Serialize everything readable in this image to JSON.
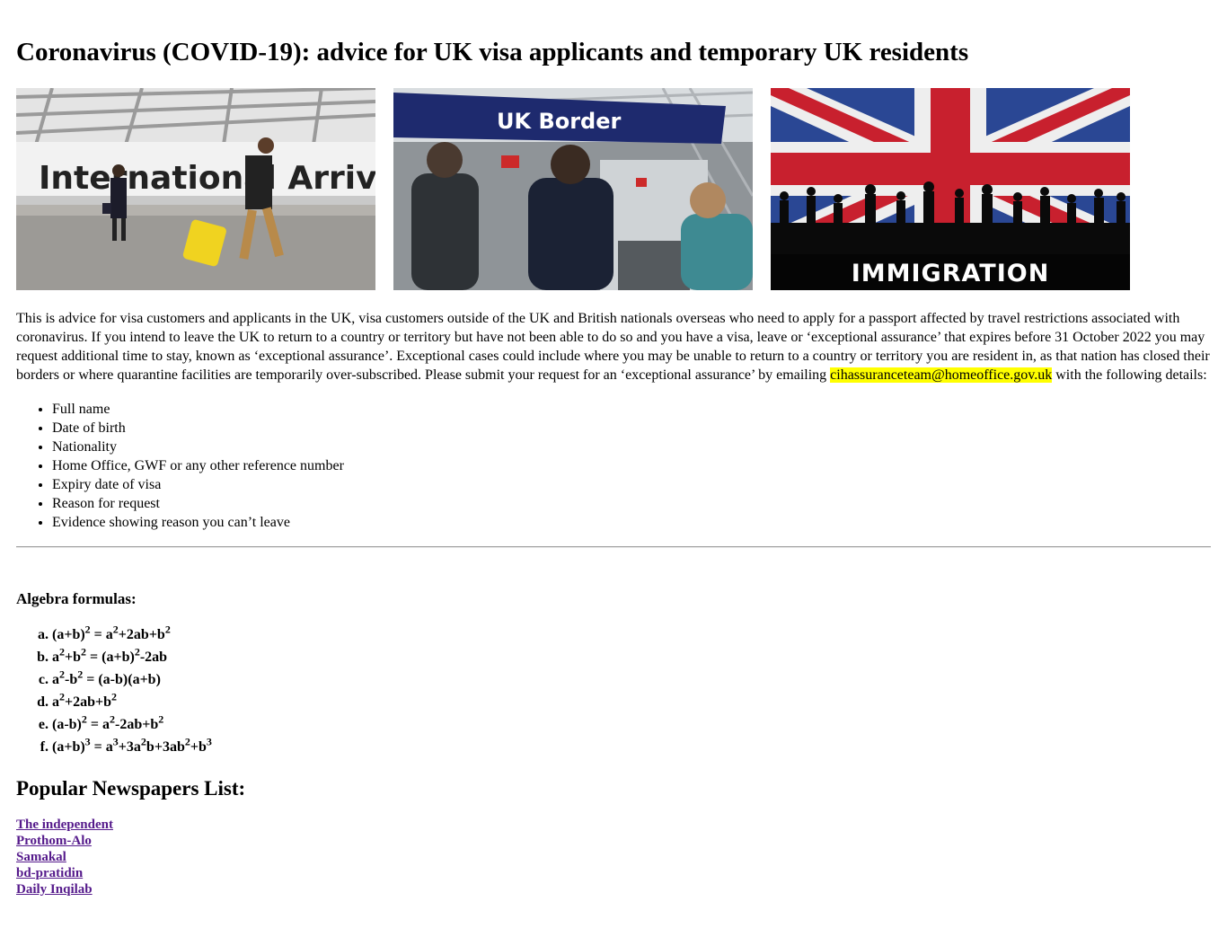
{
  "page": {
    "title": "Coronavirus (COVID-19): advice for UK visa applicants and temporary UK residents"
  },
  "images": [
    {
      "caption": "International Arrivals",
      "icon": "airport-arrivals-photo"
    },
    {
      "caption": "UK Border",
      "icon": "uk-border-photo"
    },
    {
      "caption": "IMMIGRATION",
      "icon": "immigration-flag-photo"
    }
  ],
  "intro": {
    "text_before": "This is advice for visa customers and applicants in the UK, visa customers outside of the UK and British nationals overseas who need to apply for a passport affected by travel restrictions associated with coronavirus. If you intend to leave the UK to return to a country or territory but have not been able to do so and you have a visa, leave or ‘exceptional assurance’ that expires before 31 October 2022 you may request additional time to stay, known as ‘exceptional assurance’. Exceptional cases could include where you may be unable to return to a country or territory you are resident in, as that nation has closed their borders or where quarantine facilities are temporarily over-subscribed. Please submit your request for an ‘exceptional assurance’ by emailing ",
    "email": "cihassuranceteam@homeoffice.gov.uk",
    "text_after": " with the following details:",
    "highlight_color": "#ffff00"
  },
  "details": [
    "Full name",
    "Date of birth",
    "Nationality",
    "Home Office, GWF or any other reference number",
    "Expiry date of visa",
    "Reason for request",
    "Evidence showing reason you can’t leave"
  ],
  "algebra": {
    "title": "Algebra formulas:",
    "formulas": [
      [
        [
          "(a+b)",
          ""
        ],
        [
          "",
          "2"
        ],
        [
          " = a",
          ""
        ],
        [
          "",
          "2"
        ],
        [
          "+2ab+b",
          ""
        ],
        [
          "",
          "2"
        ]
      ],
      [
        [
          "a",
          ""
        ],
        [
          "",
          "2"
        ],
        [
          "+b",
          ""
        ],
        [
          "",
          "2"
        ],
        [
          " = (a+b)",
          ""
        ],
        [
          "",
          "2"
        ],
        [
          "-2ab",
          ""
        ]
      ],
      [
        [
          "a",
          ""
        ],
        [
          "",
          "2"
        ],
        [
          "-b",
          ""
        ],
        [
          "",
          "2"
        ],
        [
          " = (a-b)(a+b)",
          ""
        ]
      ],
      [
        [
          "a",
          ""
        ],
        [
          "",
          "2"
        ],
        [
          "+2ab+b",
          ""
        ],
        [
          "",
          "2"
        ]
      ],
      [
        [
          "(a-b)",
          ""
        ],
        [
          "",
          "2"
        ],
        [
          " = a",
          ""
        ],
        [
          "",
          "2"
        ],
        [
          "-2ab+b",
          ""
        ],
        [
          "",
          "2"
        ]
      ],
      [
        [
          "(a+b)",
          ""
        ],
        [
          "",
          "3"
        ],
        [
          " = a",
          ""
        ],
        [
          "",
          "3"
        ],
        [
          "+3a",
          ""
        ],
        [
          "",
          "2"
        ],
        [
          "b+3ab",
          ""
        ],
        [
          "",
          "2"
        ],
        [
          "+b",
          ""
        ],
        [
          "",
          "3"
        ]
      ]
    ]
  },
  "newspapers": {
    "title": "Popular Newspapers List:",
    "links": [
      "The independent",
      "Prothom-Alo",
      "Samakal",
      "bd-pratidin",
      "Daily Inqilab"
    ],
    "link_color": "#551a8b"
  }
}
